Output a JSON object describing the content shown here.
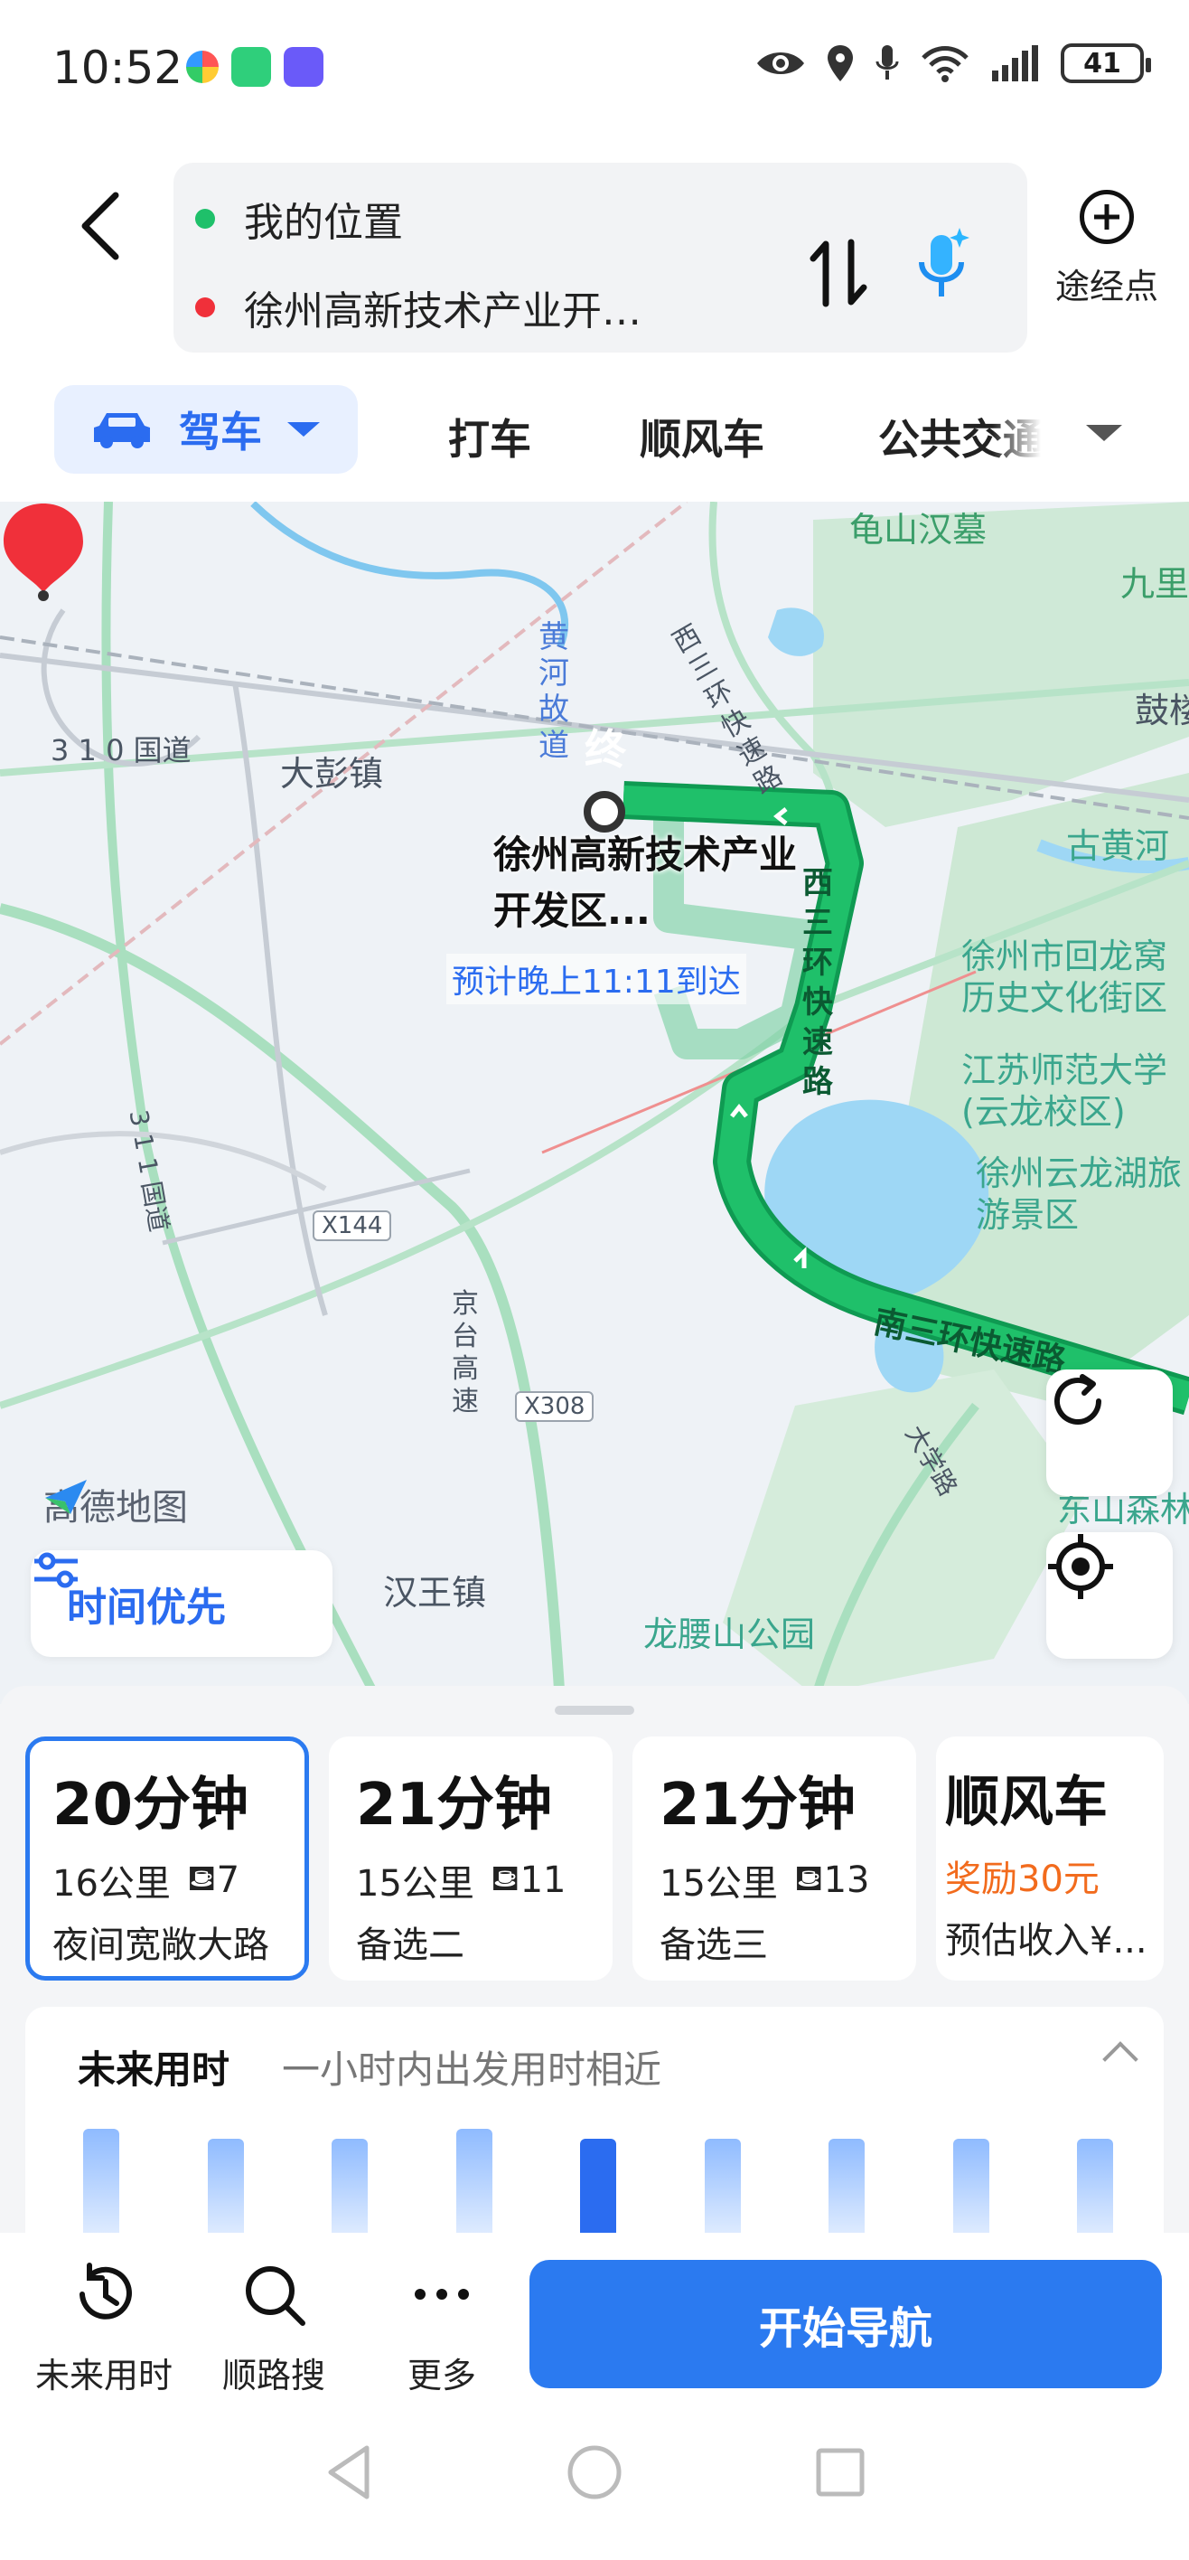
{
  "status_bar": {
    "time": "10:52",
    "battery": "41"
  },
  "route": {
    "origin": "我的位置",
    "destination": "徐州高新技术产业开…",
    "waypoint_label": "途经点"
  },
  "tabs": {
    "active": "驾车",
    "items": [
      "打车",
      "顺风车",
      "公共交通"
    ]
  },
  "map": {
    "labels": {
      "guishan": "龟山汉墓",
      "jiuli": "九里",
      "gu": "鼓楼",
      "huanghe_road": "黄河故道",
      "xisanhuan": "西三环快速路",
      "g310": "3 1 0 国道",
      "dapeng": "大彭镇",
      "gu_huanghe": "古黄河",
      "huilongwo": "徐州市回龙窝历史文化街区",
      "jiangsu_normal": "江苏师范大学(云龙校区)",
      "yunlonghu": "徐州云龙湖旅游景区",
      "g311": "3 1 1 国道",
      "x144": "X144",
      "jingtai": "京台高速",
      "x308": "X308",
      "nansanhuan": "南三环快速路",
      "xisanhuan_route": "西三环快速路",
      "hanwang": "汉王镇",
      "longyaoshan": "龙腰山公园",
      "daxue_road": "大学路",
      "dongshan": "东山森林",
      "logo": "高德地图"
    },
    "destination_marker": "终",
    "destination_name": "徐州高新技术产业开发区...",
    "eta": "预计晚上11:11到达",
    "preference_button": "时间优先"
  },
  "route_options": [
    {
      "time": "20分钟",
      "distance": "16公里",
      "lights": "7",
      "tag": "夜间宽敞大路"
    },
    {
      "time": "21分钟",
      "distance": "15公里",
      "lights": "11",
      "tag": "备选二"
    },
    {
      "time": "21分钟",
      "distance": "15公里",
      "lights": "13",
      "tag": "备选三"
    },
    {
      "title": "顺风车",
      "reward": "奖励30元",
      "income": "预估收入¥..."
    }
  ],
  "future": {
    "title": "未来用时",
    "hint": "一小时内出发用时相近",
    "bar_values": [
      0.55,
      0.5,
      0.5,
      0.55,
      0.5,
      0.5,
      0.5,
      0.5,
      0.5
    ],
    "current_index": 4
  },
  "actions": {
    "future_time": "未来用时",
    "search_along": "顺路搜",
    "more": "更多",
    "start": "开始导航"
  },
  "colors": {
    "accent": "#2b7af0",
    "route_green": "#1fb865",
    "reward_orange": "#f26b1d"
  }
}
